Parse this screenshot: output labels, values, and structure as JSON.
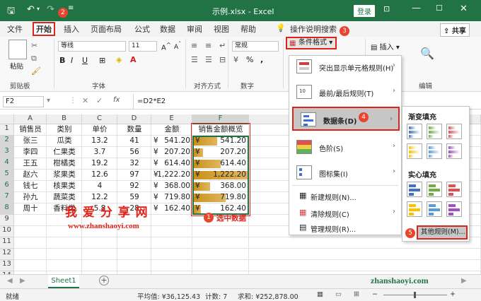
{
  "titlebar": {
    "filename": "示例.xlsx",
    "sep": "-",
    "app": "Excel",
    "login": "登录"
  },
  "tabs": [
    "文件",
    "开始",
    "插入",
    "页面布局",
    "公式",
    "数据",
    "审阅",
    "视图",
    "帮助",
    "操作说明搜索"
  ],
  "share": "共享",
  "ribbon": {
    "paste": "粘贴",
    "clipboard": "剪贴板",
    "font_group": "字体",
    "font_name": "等线",
    "font_size": "11",
    "bold": "B",
    "italic": "I",
    "underline": "U",
    "align_group": "对齐方式",
    "number_group": "数字",
    "number_format": "常规",
    "percent": "%",
    "comma": ",",
    "cond_format": "条件格式",
    "insert": "插入",
    "edit": "编辑"
  },
  "formula": {
    "namebox": "F2",
    "fx": "fx",
    "formula": "=D2*E2"
  },
  "columns": [
    "A",
    "B",
    "C",
    "D",
    "E",
    "F"
  ],
  "rows": [
    "1",
    "2",
    "3",
    "4",
    "5",
    "6",
    "7",
    "8",
    "9",
    "10",
    "11",
    "12",
    "13",
    "14"
  ],
  "headers": [
    "销售员",
    "类别",
    "单价",
    "数量",
    "金额",
    "销售金额概览"
  ],
  "data": [
    {
      "a": "张三",
      "b": "瓜类",
      "c": "13.2",
      "d": "41",
      "e_cur": "¥",
      "e": "541.20",
      "f_cur": "¥",
      "f": "541.20",
      "frac": 0.44
    },
    {
      "a": "李四",
      "b": "仁果类",
      "c": "3.7",
      "d": "56",
      "e_cur": "¥",
      "e": "207.20",
      "f_cur": "¥",
      "f": "207.20",
      "frac": 0.17
    },
    {
      "a": "王五",
      "b": "柑橘类",
      "c": "19.2",
      "d": "32",
      "e_cur": "¥",
      "e": "614.40",
      "f_cur": "¥",
      "f": "614.40",
      "frac": 0.5
    },
    {
      "a": "赵六",
      "b": "浆果类",
      "c": "12.6",
      "d": "97",
      "e_cur": "¥",
      "e": "1,222.20",
      "f_cur": "¥",
      "f": "1,222.20",
      "frac": 1.0
    },
    {
      "a": "钱七",
      "b": "核果类",
      "c": "4",
      "d": "92",
      "e_cur": "¥",
      "e": "368.00",
      "f_cur": "¥",
      "f": "368.00",
      "frac": 0.3
    },
    {
      "a": "孙九",
      "b": "蔬菜类",
      "c": "12.2",
      "d": "59",
      "e_cur": "¥",
      "e": "719.80",
      "f_cur": "¥",
      "f": "719.80",
      "frac": 0.59
    },
    {
      "a": "周十",
      "b": "香料类",
      "c": "5.8",
      "d": "28",
      "e_cur": "¥",
      "e": "162.40",
      "f_cur": "¥",
      "f": "162.40",
      "frac": 0.13
    }
  ],
  "menu": [
    {
      "label": "突出显示单元格规则(H)",
      "arrow": "›"
    },
    {
      "label": "最前/最后规则(T)",
      "arrow": "›"
    },
    {
      "label": "数据条(D)",
      "arrow": "›"
    },
    {
      "label": "色阶(S)",
      "arrow": "›"
    },
    {
      "label": "图标集(I)",
      "arrow": "›"
    },
    {
      "label": "新建规则(N)...",
      "arrow": ""
    },
    {
      "label": "清除规则(C)",
      "arrow": "›"
    },
    {
      "label": "管理规则(R)...",
      "arrow": ""
    }
  ],
  "submenu": {
    "gradient": "渐变填充",
    "solid": "实心填充",
    "more": "其他规则(M)..."
  },
  "badges": [
    "1",
    "2",
    "3",
    "4",
    "5"
  ],
  "annotation": "选中数据",
  "watermark": {
    "cn": "我 爱 分 享 网",
    "url": "www.zhanshaoyi.com",
    "url2": "zhanshaoyi.com"
  },
  "sheet": {
    "name": "Sheet1",
    "add": "+"
  },
  "status": {
    "ready": "就绪",
    "avg": "平均值: ¥36,125.43",
    "count": "计数: 7",
    "sum": "求和: ¥252,878.00"
  },
  "colors": {
    "accent": "#217346",
    "databar": "#c9921a",
    "badge": "#e8442e"
  }
}
